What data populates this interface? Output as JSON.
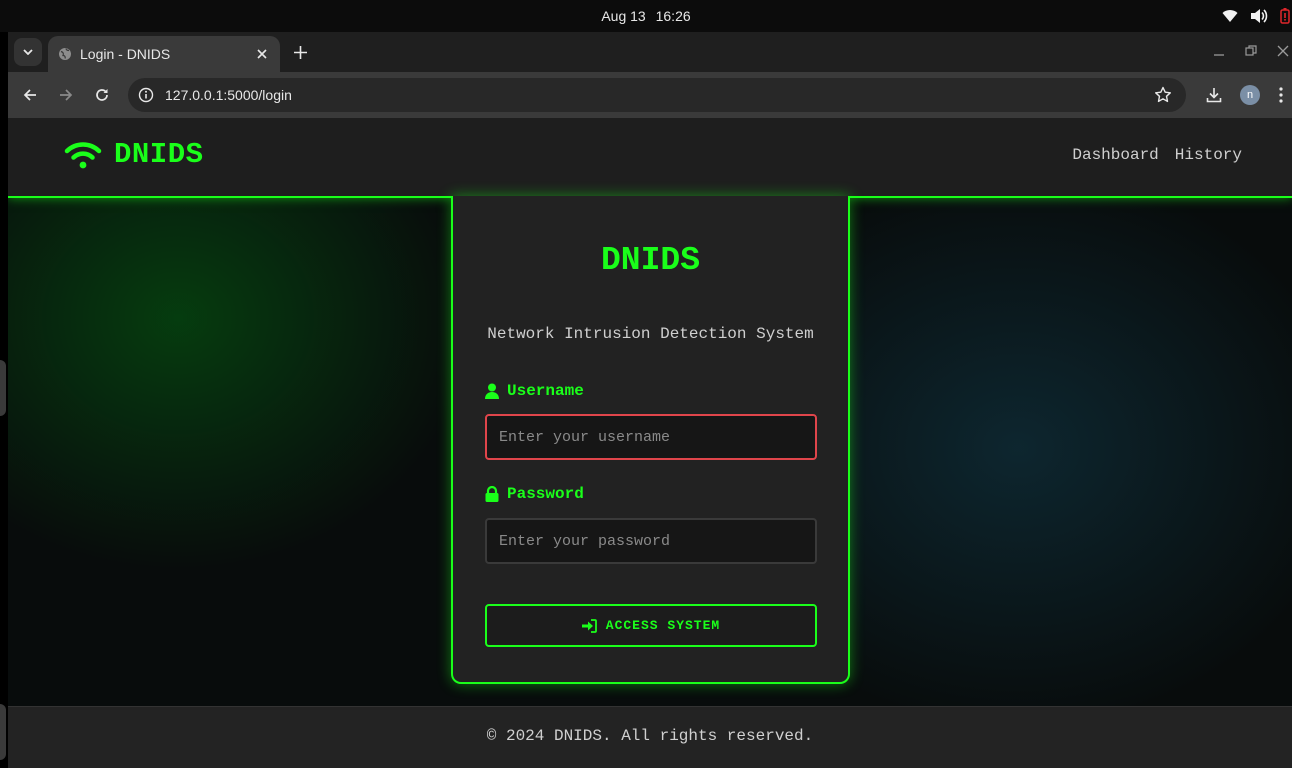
{
  "os": {
    "date": "Aug 13",
    "time": "16:26"
  },
  "browser": {
    "tab_title": "Login - DNIDS",
    "url": "127.0.0.1:5000/login",
    "profile_initial": "n"
  },
  "site": {
    "brand": "DNIDS",
    "nav": [
      "Dashboard",
      "History"
    ]
  },
  "login": {
    "title": "DNIDS",
    "subtitle": "Network Intrusion Detection System",
    "username_label": "Username",
    "username_placeholder": "Enter your username",
    "username_value": "",
    "password_label": "Password",
    "password_placeholder": "Enter your password",
    "password_value": "",
    "submit_label": "ACCESS SYSTEM"
  },
  "footer": {
    "text": "© 2024 DNIDS. All rights reserved."
  },
  "colors": {
    "accent": "#1aff1a",
    "error": "#e0454b",
    "card": "#222222",
    "header": "#1e1e1e"
  },
  "icons": [
    "wifi-icon",
    "volume-icon",
    "battery-icon",
    "globe-icon",
    "user-icon",
    "lock-icon",
    "sign-in-icon",
    "star-icon",
    "download-icon",
    "kebab-menu-icon"
  ]
}
